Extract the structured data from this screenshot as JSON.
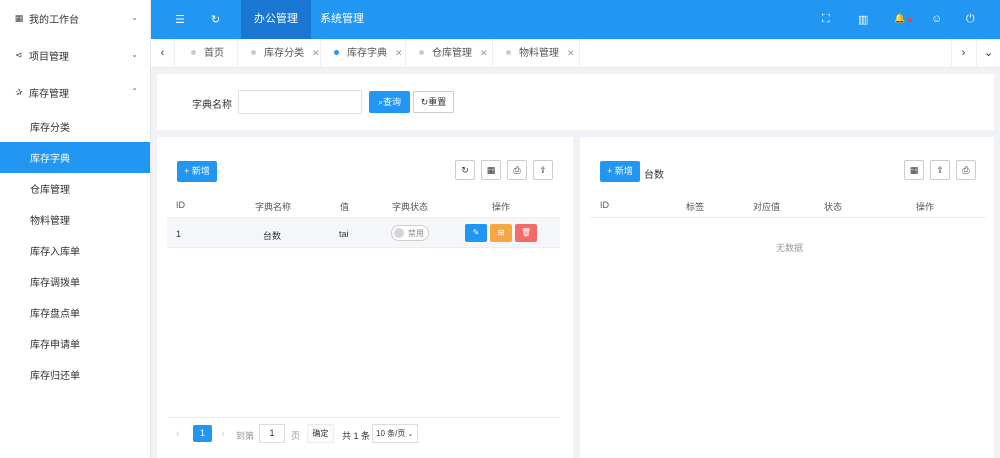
{
  "sidebar": {
    "groups": [
      {
        "icon": "▦",
        "label": "我的工作台",
        "chevron": "⌄"
      },
      {
        "icon": "⋖",
        "label": "项目管理",
        "chevron": "⌄"
      },
      {
        "icon": "✰",
        "label": "库存管理",
        "chevron": "⌃"
      }
    ],
    "items": [
      {
        "label": "库存分类"
      },
      {
        "label": "库存字典"
      },
      {
        "label": "仓库管理"
      },
      {
        "label": "物料管理"
      },
      {
        "label": "库存入库单"
      },
      {
        "label": "库存调拨单"
      },
      {
        "label": "库存盘点单"
      },
      {
        "label": "库存申请单"
      },
      {
        "label": "库存归还单"
      }
    ]
  },
  "topbar": {
    "menu_icon": "☰",
    "refresh_icon": "↻",
    "tabs": [
      {
        "label": "办公管理"
      },
      {
        "label": "系统管理"
      }
    ],
    "fullscreen_icon": "⛶",
    "layout_icon": "▥",
    "bell_icon": "🔔",
    "user_icon": "☺",
    "power_icon": "⏻"
  },
  "tabbar": {
    "prev": "‹",
    "next": "›",
    "more": "⌄",
    "tabs": [
      {
        "label": "首页",
        "close": ""
      },
      {
        "label": "库存分类",
        "close": "✕"
      },
      {
        "label": "库存字典",
        "close": "✕"
      },
      {
        "label": "仓库管理",
        "close": "✕"
      },
      {
        "label": "物料管理",
        "close": "✕"
      }
    ]
  },
  "search": {
    "label": "字典名称",
    "input_value": "",
    "query_button": "查询",
    "query_icon": "⌕",
    "reset_button": "重置",
    "reset_icon": "↻"
  },
  "left_panel": {
    "add_button": "+ 新增",
    "columns": [
      "ID",
      "字典名称",
      "值",
      "字典状态",
      "操作"
    ],
    "rows": [
      {
        "id": "1",
        "name": "台数",
        "value": "tai",
        "status": "禁用"
      }
    ],
    "tool_icons": {
      "refresh": "↻",
      "columns": "▦",
      "print": "⎙",
      "export": "⇪"
    },
    "action_icons": {
      "edit": "✎",
      "config": "⊞",
      "delete": "🗑"
    }
  },
  "right_panel": {
    "add_button": "+ 新增",
    "title": "台数",
    "columns": [
      "ID",
      "标签",
      "对应值",
      "状态",
      "操作"
    ],
    "empty_text": "无数据",
    "tool_icons": {
      "columns": "▦",
      "export": "⇪",
      "print": "⎙"
    }
  },
  "pagination": {
    "prev": "‹",
    "current_page": "1",
    "next": "›",
    "goto_label": "到第",
    "goto_value": "1",
    "page_unit": "页",
    "confirm": "确定",
    "total": "共 1 条",
    "page_size": "10 条/页"
  },
  "colors": {
    "primary": "#2196f3",
    "warning": "#f4a742",
    "danger": "#f46a6a"
  }
}
